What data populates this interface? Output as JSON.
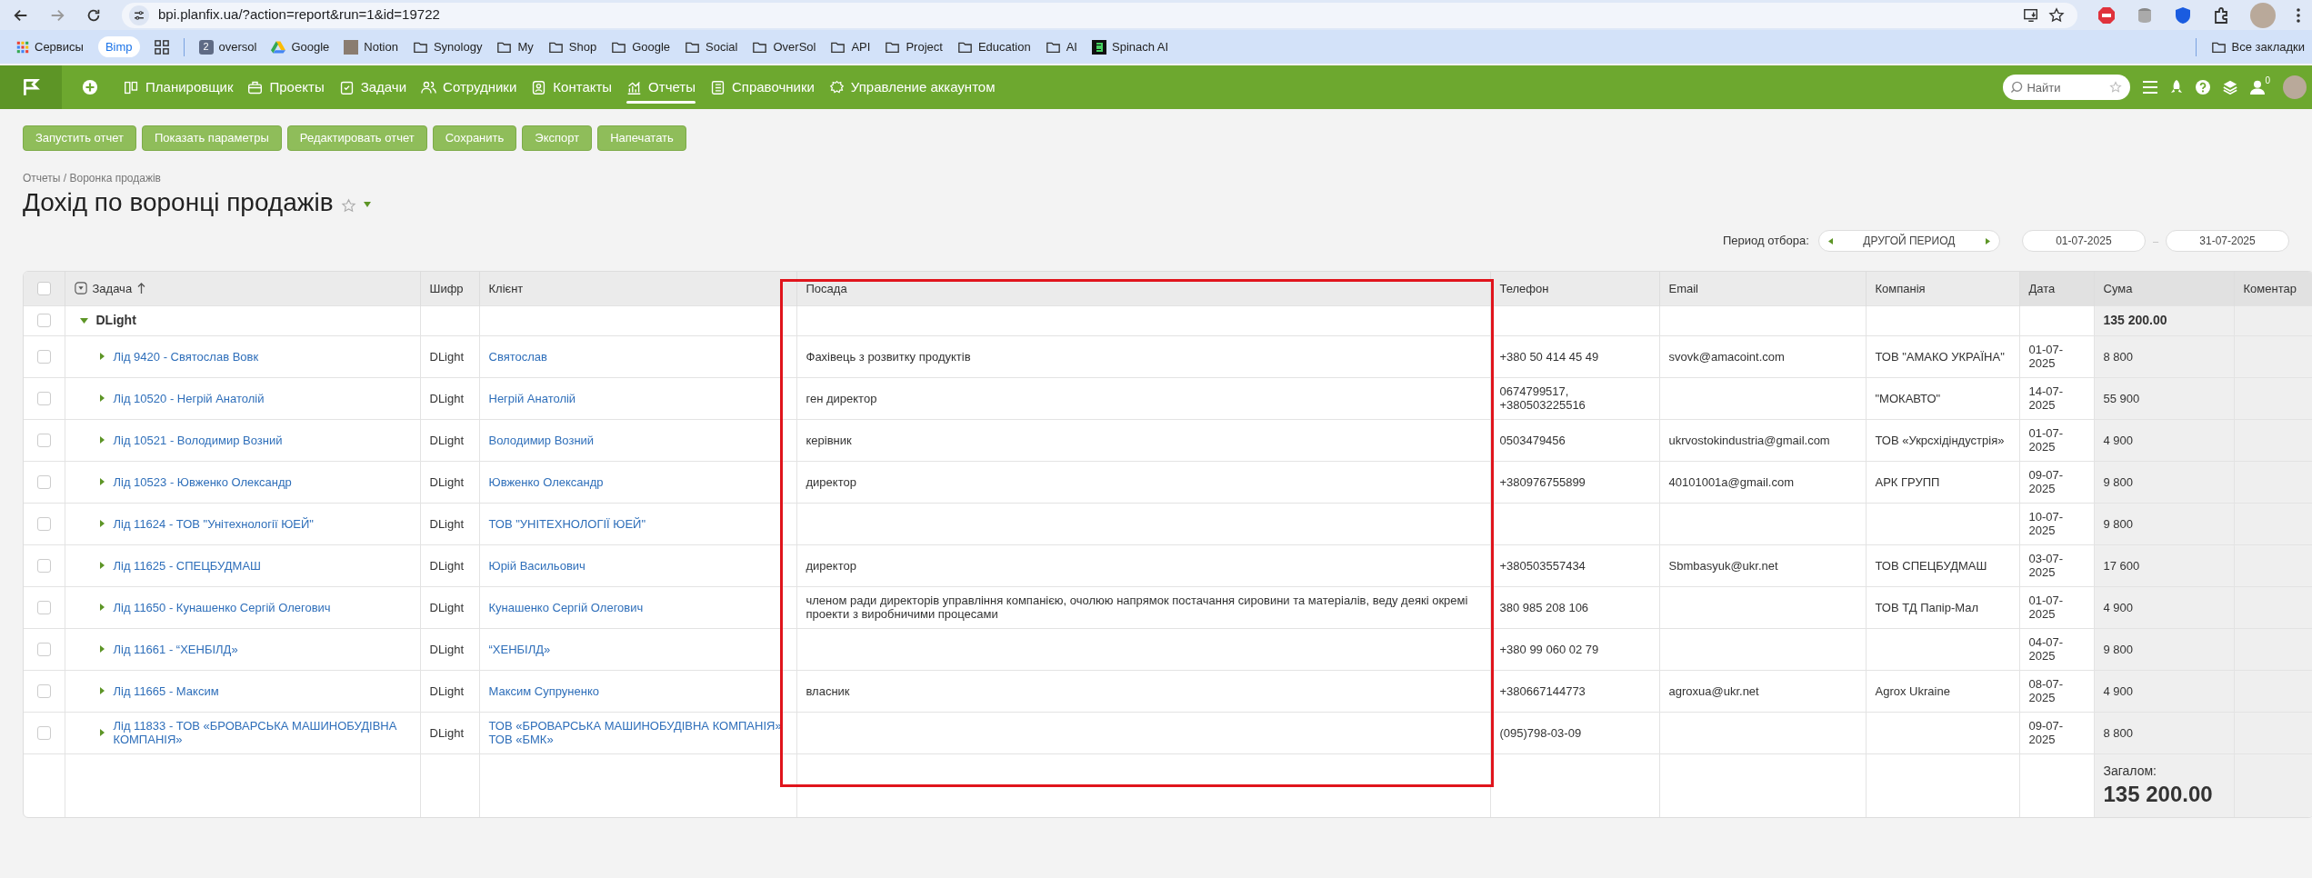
{
  "browser": {
    "url": "bpi.planfix.ua/?action=report&run=1&id=19722",
    "bookmarks": [
      {
        "label": "Сервисы",
        "kind": "apps"
      },
      {
        "label": "Bimp",
        "kind": "pill"
      },
      {
        "kind": "grid"
      },
      {
        "label": "oversol",
        "kind": "numbered",
        "badge": "2"
      },
      {
        "label": "Google",
        "kind": "drive"
      },
      {
        "label": "Notion",
        "kind": "avatar"
      },
      {
        "label": "Synology",
        "kind": "folder"
      },
      {
        "label": "My",
        "kind": "folder"
      },
      {
        "label": "Shop",
        "kind": "folder"
      },
      {
        "label": "Google",
        "kind": "folder"
      },
      {
        "label": "Social",
        "kind": "folder"
      },
      {
        "label": "OverSol",
        "kind": "folder"
      },
      {
        "label": "API",
        "kind": "folder"
      },
      {
        "label": "Project",
        "kind": "folder"
      },
      {
        "label": "Education",
        "kind": "folder"
      },
      {
        "label": "AI",
        "kind": "folder"
      },
      {
        "label": "Spinach AI",
        "kind": "app"
      }
    ],
    "all_bookmarks": "Все закладки"
  },
  "nav": {
    "items": [
      {
        "label": "Планировщик",
        "selected": false
      },
      {
        "label": "Проекты",
        "selected": false
      },
      {
        "label": "Задачи",
        "selected": false
      },
      {
        "label": "Сотрудники",
        "selected": false
      },
      {
        "label": "Контакты",
        "selected": false
      },
      {
        "label": "Отчеты",
        "selected": true
      },
      {
        "label": "Справочники",
        "selected": false
      },
      {
        "label": "Управление аккаунтом",
        "selected": false
      }
    ],
    "search": {
      "placeholder": "Найти"
    },
    "notifications": "0"
  },
  "toolbar": [
    "Запустить отчет",
    "Показать параметры",
    "Редактировать отчет",
    "Сохранить",
    "Экспорт",
    "Напечатать"
  ],
  "breadcrumb": "Отчеты / Воронка продажів",
  "title": "Дохід по воронці продажів",
  "period": {
    "label": "Период отбора:",
    "preset": "ДРУГОЙ ПЕРИОД",
    "from": "01-07-2025",
    "separator": "–",
    "to": "31-07-2025"
  },
  "table": {
    "select_all_checked": false,
    "columns": [
      "Задача",
      "Шифр",
      "Клієнт",
      "Посада",
      "Телефон",
      "Email",
      "Компанія",
      "Дата",
      "Сума",
      "Коментар"
    ],
    "group": {
      "name": "DLight",
      "total": "135 200.00",
      "checked": false
    },
    "rows": [
      {
        "checked": false,
        "task": "Лід 9420 - Святослав Вовк",
        "code": "DLight",
        "client": "Святослав",
        "position": "Фахівець з розвитку продуктів",
        "phone": "+380 50 414 45 49",
        "email": "svovk@amacoint.com",
        "company": "ТОВ \"АМАКО УКРАЇНА\"",
        "date": "01-07-2025",
        "sum": "8 800"
      },
      {
        "checked": false,
        "task": "Лід 10520 - Негрій Анатолій",
        "code": "DLight",
        "client": "Негрій Анатолій",
        "position": "ген директор",
        "phone": "0674799517, +380503225516",
        "email": "",
        "company": "\"МОКАВТО\"",
        "date": "14-07-2025",
        "sum": "55 900"
      },
      {
        "checked": false,
        "task": "Лід 10521 - Володимир Возний",
        "code": "DLight",
        "client": "Володимир Возний",
        "position": "керівник",
        "phone": "0503479456",
        "email": "ukrvostokindustria@gmail.com",
        "company": "ТОВ «Укрсхідіндустрія»",
        "date": "01-07-2025",
        "sum": "4 900"
      },
      {
        "checked": false,
        "task": "Лід 10523 - Ювженко Олександр",
        "code": "DLight",
        "client": "Ювженко Олександр",
        "position": "директор",
        "phone": "+380976755899",
        "email": "40101001a@gmail.com",
        "company": "АРК ГРУПП",
        "date": "09-07-2025",
        "sum": "9 800"
      },
      {
        "checked": false,
        "task": "Лід 11624 - ТОВ \"Унітехнології ЮЕЙ\"",
        "code": "DLight",
        "client": "ТОВ \"УНІТЕХНОЛОГІЇ ЮЕЙ\"",
        "position": "",
        "phone": "",
        "email": "",
        "company": "",
        "date": "10-07-2025",
        "sum": "9 800"
      },
      {
        "checked": false,
        "task": "Лід 11625 - СПЕЦБУДМАШ",
        "code": "DLight",
        "client": "Юрій Васильович",
        "position": "директор",
        "phone": "+380503557434",
        "email": "Sbmbasyuk@ukr.net",
        "company": "ТОВ СПЕЦБУДМАШ",
        "date": "03-07-2025",
        "sum": "17 600"
      },
      {
        "checked": false,
        "task": "Лід 11650 - Кунашенко Сергій Олегович",
        "code": "DLight",
        "client": "Кунашенко Сергій Олегович",
        "position": "членом ради директорів управління компанією, очолюю напрямок постачання сировини та матеріалів, веду деякі окремі проекти з виробничими процесами",
        "phone": "380 985 208 106",
        "email": "",
        "company": "ТОВ ТД Папір-Мал",
        "date": "01-07-2025",
        "sum": "4 900"
      },
      {
        "checked": false,
        "task": "Лід 11661 - “ХЕНБІЛД»",
        "code": "DLight",
        "client": "“ХЕНБІЛД»",
        "position": "",
        "phone": "+380 99 060 02 79",
        "email": "",
        "company": "",
        "date": "04-07-2025",
        "sum": "9 800"
      },
      {
        "checked": false,
        "task": "Лід 11665 - Максим",
        "code": "DLight",
        "client": "Максим Супруненко",
        "position": "власник",
        "phone": "+380667144773",
        "email": "agroxua@ukr.net",
        "company": "Agrox Ukraine",
        "date": "08-07-2025",
        "sum": "4 900"
      },
      {
        "checked": false,
        "task": "Лід 11833 - ТОВ «БРОВАРСЬКА МАШИНОБУДІВНА КОМПАНІЯ»",
        "code": "DLight",
        "client": "ТОВ «БРОВАРСЬКА МАШИНОБУДІВНА КОМПАНІЯ» ТОВ «БМК»",
        "position": "",
        "phone": "(095)798-03-09",
        "email": "",
        "company": "",
        "date": "09-07-2025",
        "sum": "8 800"
      }
    ],
    "footer": {
      "label": "Загалом:",
      "total": "135 200.00"
    }
  }
}
